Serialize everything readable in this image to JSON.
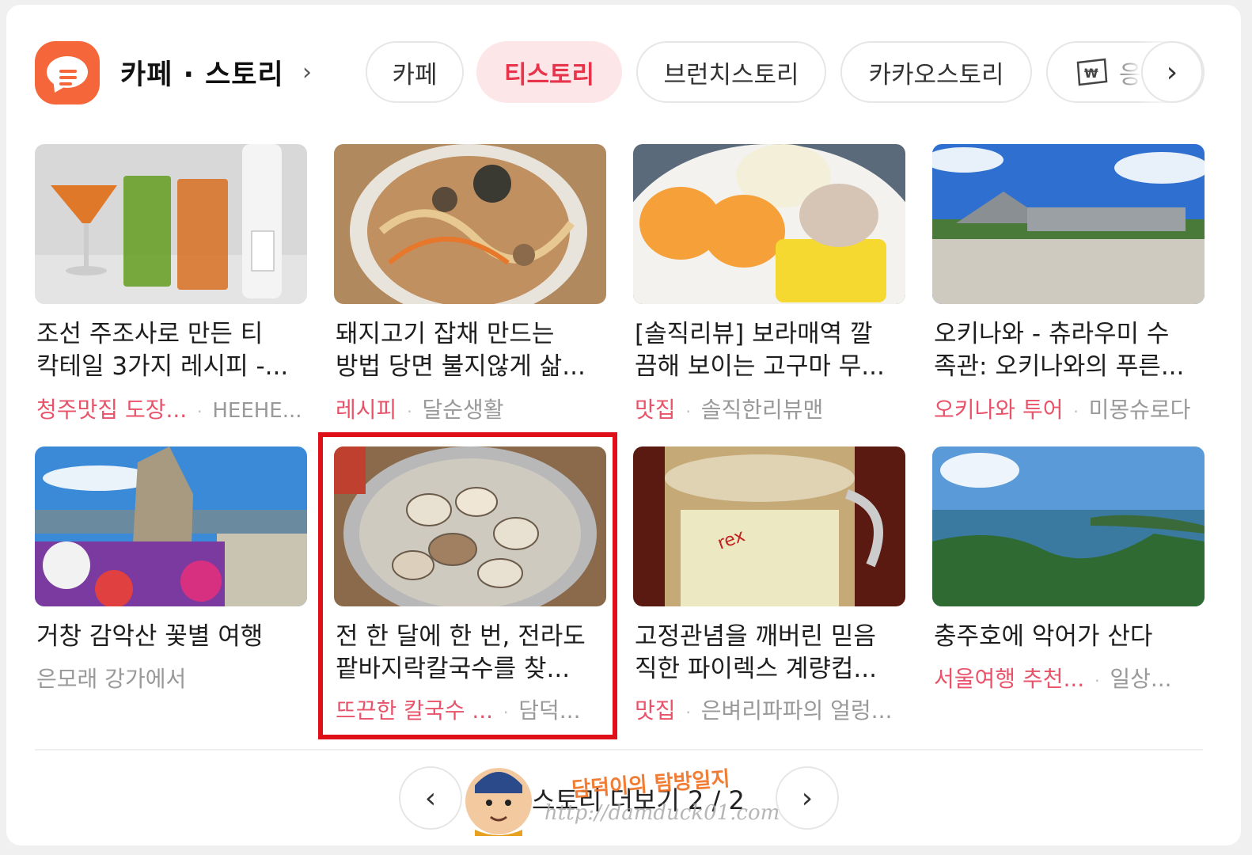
{
  "header": {
    "section_title": "카페 · 스토리",
    "section_chevron": "›",
    "tabs": [
      {
        "label": "카페"
      },
      {
        "label": "티스토리",
        "active": true
      },
      {
        "label": "브런치스토리"
      },
      {
        "label": "카카오스토리"
      },
      {
        "label": "응"
      }
    ],
    "scroll_next": "›"
  },
  "posts": [
    {
      "title_line1": "조선 주조사로 만든 티",
      "title_line2": "칵테일 3가지 레시피 -...",
      "category": "청주맛집 도장...",
      "author": "HEEHE..."
    },
    {
      "title_line1": "돼지고기 잡채 만드는",
      "title_line2": "방법 당면 불지않게 삶...",
      "category": "레시피",
      "author": "달순생활"
    },
    {
      "title_line1": "[솔직리뷰] 보라매역 깔",
      "title_line2": "끔해 보이는 고구마 무...",
      "category": "맛집",
      "author": "솔직한리뷰맨"
    },
    {
      "title_line1": "오키나와 - 츄라우미 수",
      "title_line2": "족관: 오키나와의 푸른...",
      "category": "오키나와 투어",
      "author": "미몽슈로다"
    },
    {
      "title_line1": "거창 감악산 꽃별 여행",
      "title_line2": "",
      "category": "",
      "author": "은모래 강가에서"
    },
    {
      "title_line1": "전 한 달에 한 번, 전라도",
      "title_line2": "팥바지락칼국수를 찾...",
      "category": "뜨끈한 칼국수 ...",
      "author": "담덕..."
    },
    {
      "title_line1": "고정관념을 깨버린 믿음",
      "title_line2": "직한 파이렉스 계량컵...",
      "category": "맛집",
      "author": "은벼리파파의 얼렁..."
    },
    {
      "title_line1": "충주호에 악어가 산다",
      "title_line2": "",
      "category": "서울여행 추천...",
      "author": "일상..."
    }
  ],
  "pager": {
    "prev": "‹",
    "next": "›",
    "label": "스토리 더보기 2 / 2"
  },
  "watermark": {
    "name": "담덕이의 탐방일지",
    "url": "http://damduck01.com"
  },
  "colors": {
    "accent": "#e8344b",
    "logo": "#f5673a",
    "highlight_box": "#e0101a"
  }
}
